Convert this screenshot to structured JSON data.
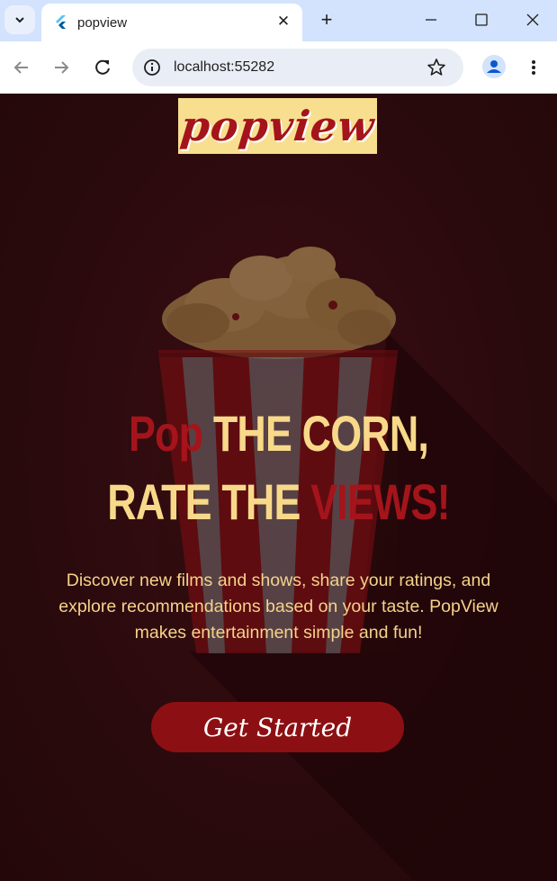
{
  "browser": {
    "tab_title": "popview",
    "url": "localhost:55282",
    "new_tab_symbol": "+",
    "close_symbol": "✕"
  },
  "page": {
    "logo_text": "popview",
    "headline_line1_accent": "Pop",
    "headline_line1_rest": " THE CORN,",
    "headline_line2_start": "RATE THE ",
    "headline_line2_accent": "VIEWS!",
    "description": "Discover new films and shows, share your ratings, and explore recommendations based on your taste. PopView makes entertainment simple and fun!",
    "cta_label": "Get Started"
  },
  "colors": {
    "background": "#2b0b0e",
    "accent_red": "#a5141b",
    "accent_yellow": "#f8d98a",
    "button": "#8c1013"
  }
}
